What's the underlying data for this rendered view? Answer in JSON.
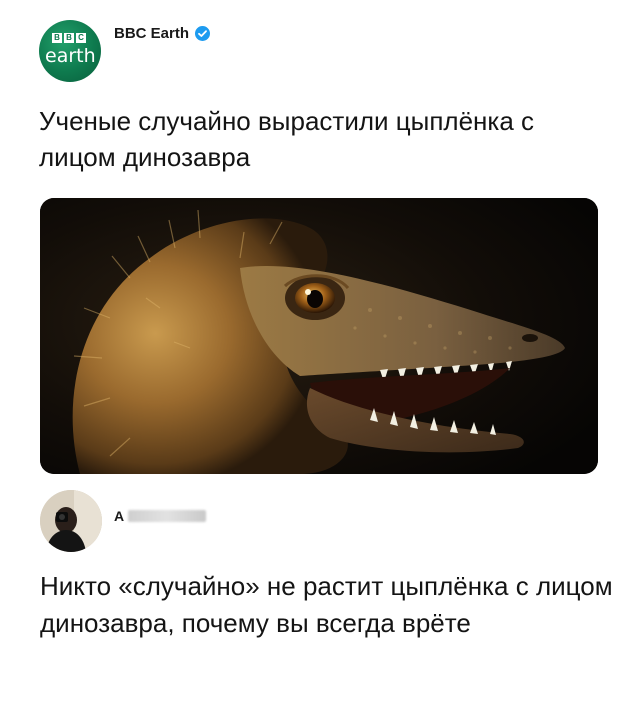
{
  "post": {
    "account": {
      "name": "BBC Earth",
      "avatar_logo_letters": [
        "B",
        "B",
        "C"
      ],
      "avatar_logo_word": "earth",
      "verified_icon": "verified-badge-icon",
      "accent_color": "#0e7a4e",
      "verified_color": "#1d9bf0"
    },
    "headline": "Ученые случайно вырастили цыплёнка с лицом динозавра",
    "image": {
      "subject": "bird-dinosaur-face-photo"
    }
  },
  "reply": {
    "author_initial": "A",
    "author_redacted": true,
    "text": "Никто «случайно» не растит цыплёнка с лицом динозавра, почему вы всегда врёте"
  }
}
